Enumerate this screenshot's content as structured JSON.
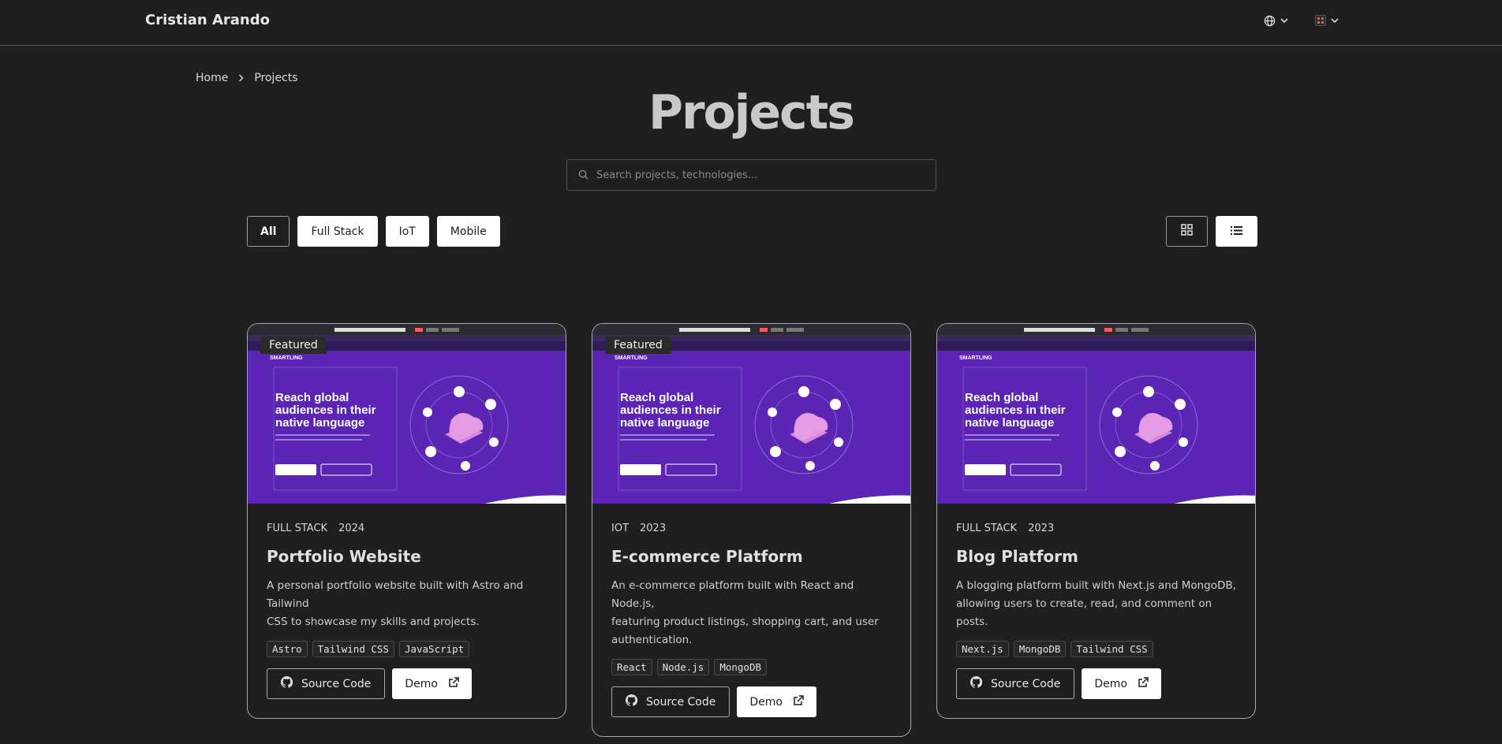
{
  "header": {
    "brand": "Cristian Arando",
    "language_icon": "globe-icon",
    "theme_icon": "theme-palette-icon"
  },
  "breadcrumb": {
    "home": "Home",
    "current": "Projects"
  },
  "page": {
    "title": "Projects"
  },
  "search": {
    "placeholder": "Search projects, technologies..."
  },
  "filters": [
    "All",
    "Full Stack",
    "IoT",
    "Mobile"
  ],
  "active_filter": "All",
  "view_modes": [
    "grid",
    "list"
  ],
  "thumbnail": {
    "logo": "SMARTLING",
    "headline": [
      "Reach global",
      "audiences in their",
      "native language"
    ]
  },
  "cards": [
    {
      "featured": "Featured",
      "category": "FULL STACK",
      "year": "2024",
      "title": "Portfolio Website",
      "description_lines": [
        "A personal portfolio website built with Astro and Tailwind",
        "CSS to showcase my skills and projects."
      ],
      "tags": [
        "Astro",
        "Tailwind CSS",
        "JavaScript"
      ],
      "source_label": "Source Code",
      "demo_label": "Demo"
    },
    {
      "featured": "Featured",
      "category": "IOT",
      "year": "2023",
      "title": "E-commerce Platform",
      "description_lines": [
        "An e-commerce platform built with React and Node.js,",
        "featuring product listings, shopping cart, and user",
        "authentication."
      ],
      "tags": [
        "React",
        "Node.js",
        "MongoDB"
      ],
      "source_label": "Source Code",
      "demo_label": "Demo"
    },
    {
      "featured": "",
      "category": "FULL STACK",
      "year": "2023",
      "title": "Blog Platform",
      "description_lines": [
        "A blogging platform built with Next.js and MongoDB,",
        "allowing users to create, read, and comment on posts."
      ],
      "tags": [
        "Next.js",
        "MongoDB",
        "Tailwind CSS"
      ],
      "source_label": "Source Code",
      "demo_label": "Demo"
    }
  ],
  "colors": {
    "background": "#1f1f1f",
    "thumbnail_purple": "#5b24b4",
    "accent_pink": "#ff5b5b"
  }
}
